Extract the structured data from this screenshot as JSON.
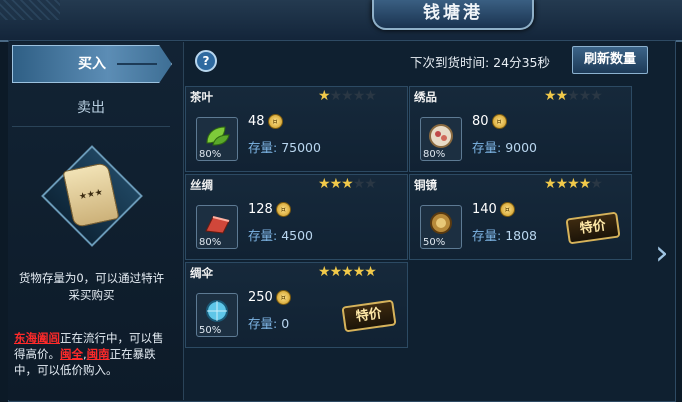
{
  "header": {
    "title": "钱塘港"
  },
  "tabs": {
    "buy": "买入",
    "sell": "卖出"
  },
  "restock": {
    "text": "下次到货时间: 24分35秒"
  },
  "refresh_button": "刷新数量",
  "help_icon": "?",
  "stock_label": "存量:",
  "special_label": "特价",
  "items": [
    {
      "name": "茶叶",
      "stars": 1,
      "price": "48",
      "stock": "75000",
      "percent": "80%",
      "special": false,
      "icon": "tea-leaf-icon"
    },
    {
      "name": "绣品",
      "stars": 2,
      "price": "80",
      "stock": "9000",
      "percent": "80%",
      "special": false,
      "icon": "embroidery-icon"
    },
    {
      "name": "丝绸",
      "stars": 3,
      "price": "128",
      "stock": "4500",
      "percent": "80%",
      "special": false,
      "icon": "silk-icon"
    },
    {
      "name": "铜镜",
      "stars": 4,
      "price": "140",
      "stock": "1808",
      "percent": "50%",
      "special": true,
      "icon": "bronze-mirror-icon"
    },
    {
      "name": "绸伞",
      "stars": 5,
      "price": "250",
      "stock": "0",
      "percent": "50%",
      "special": true,
      "icon": "silk-umbrella-icon"
    }
  ],
  "sidebar": {
    "note": "货物存量为0，可以通过特许采买购买",
    "footer": {
      "high_region": "东海阖闾",
      "high_text": "正在流行中，可以售得高价。",
      "low_region_1": "闽全",
      "comma": ",",
      "low_region_2": "闽南",
      "low_text": "正在暴跌中，可以低价购入。"
    }
  },
  "colors": {
    "accent": "#5c8db5",
    "star": "#f1c94a",
    "warning": "#ff2a2a"
  }
}
